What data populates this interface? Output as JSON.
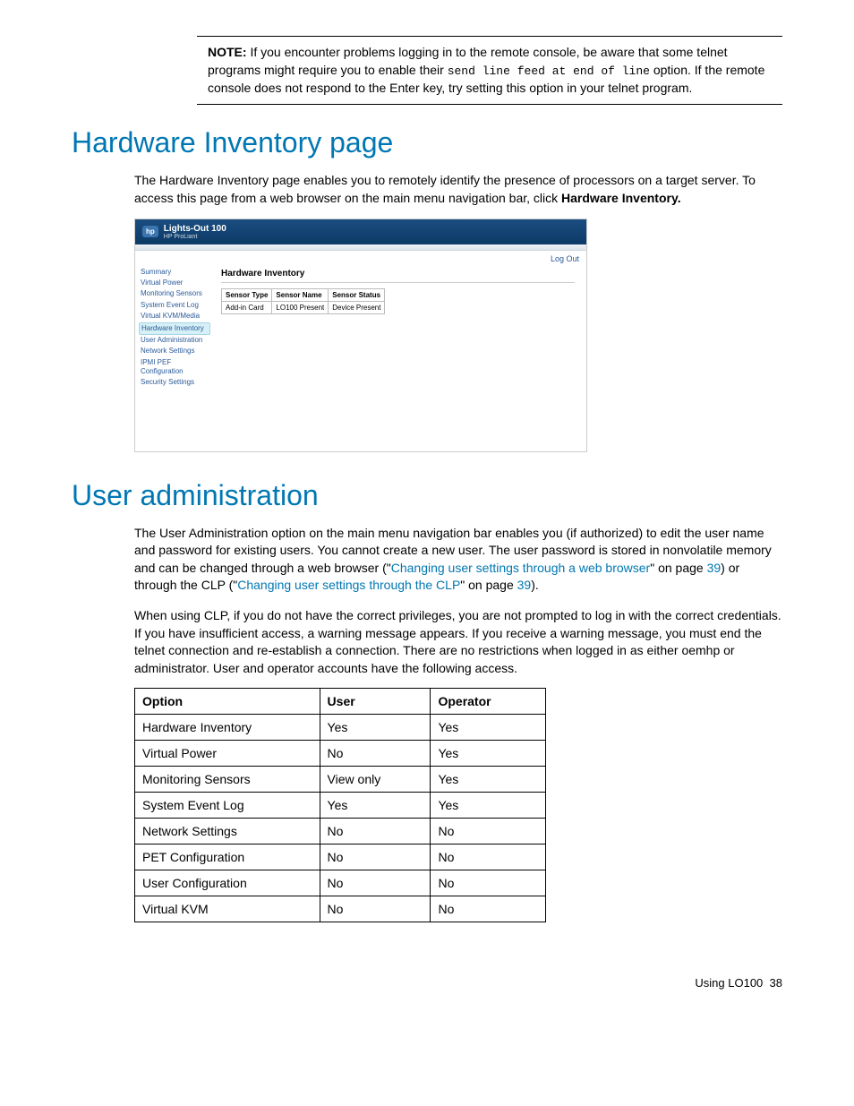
{
  "note": {
    "label": "NOTE:",
    "text_before": " If you encounter problems logging in to the remote console, be aware that some telnet programs might require you to enable their ",
    "code": "send line feed at end of line",
    "text_after": " option. If the remote console does not respond to the Enter key, try setting this option in your telnet program."
  },
  "section1": {
    "heading": "Hardware Inventory page",
    "para_before": "The Hardware Inventory page enables you to remotely identify the presence of processors on a target server. To access this page from a web browser on the main menu navigation bar, click ",
    "bold": "Hardware Inventory."
  },
  "screenshot": {
    "product": "Lights-Out 100",
    "subtitle": "HP ProLiant",
    "hp": "hp",
    "logout": "Log Out",
    "sidebar": {
      "i0": "Summary",
      "i1": "Virtual Power",
      "i2": "Monitoring Sensors",
      "i3": "System Event Log",
      "i4": "Virtual KVM/Media",
      "i5": "Hardware Inventory",
      "i6": "User Administration",
      "i7": "Network Settings",
      "i8": "IPMI PEF Configuration",
      "i9": "Security Settings"
    },
    "panel_title": "Hardware Inventory",
    "headers": {
      "h0": "Sensor Type",
      "h1": "Sensor Name",
      "h2": "Sensor Status"
    },
    "row": {
      "c0": "Add-in Card",
      "c1": "LO100 Present",
      "c2": "Device Present"
    }
  },
  "section2": {
    "heading": "User administration",
    "p1_a": "The User Administration option on the main menu navigation bar enables you (if authorized) to edit the user name and password for existing users. You cannot create a new user. The user password is stored in nonvolatile memory and can be changed through a web browser (\"",
    "p1_link1": "Changing user settings through a web browser",
    "p1_b": "\" on page ",
    "p1_page1": "39",
    "p1_c": ") or through the CLP (\"",
    "p1_link2": "Changing user settings through the CLP",
    "p1_d": "\" on page ",
    "p1_page2": "39",
    "p1_e": ").",
    "p2": "When using CLP, if you do not have the correct privileges, you are not prompted to log in with the correct credentials. If you have insufficient access, a warning message appears. If you receive a warning message, you must end the telnet connection and re-establish a connection. There are no restrictions when logged in as either oemhp or administrator. User and operator accounts have the following access."
  },
  "access_table": {
    "headers": {
      "h0": "Option",
      "h1": "User",
      "h2": "Operator"
    },
    "rows": [
      {
        "c0": "Hardware Inventory",
        "c1": "Yes",
        "c2": "Yes"
      },
      {
        "c0": "Virtual Power",
        "c1": "No",
        "c2": "Yes"
      },
      {
        "c0": "Monitoring Sensors",
        "c1": "View only",
        "c2": "Yes"
      },
      {
        "c0": "System Event Log",
        "c1": "Yes",
        "c2": "Yes"
      },
      {
        "c0": "Network Settings",
        "c1": "No",
        "c2": "No"
      },
      {
        "c0": "PET Configuration",
        "c1": "No",
        "c2": "No"
      },
      {
        "c0": "User Configuration",
        "c1": "No",
        "c2": "No"
      },
      {
        "c0": "Virtual KVM",
        "c1": "No",
        "c2": "No"
      }
    ]
  },
  "footer": {
    "text": "Using LO100",
    "page": "38"
  }
}
